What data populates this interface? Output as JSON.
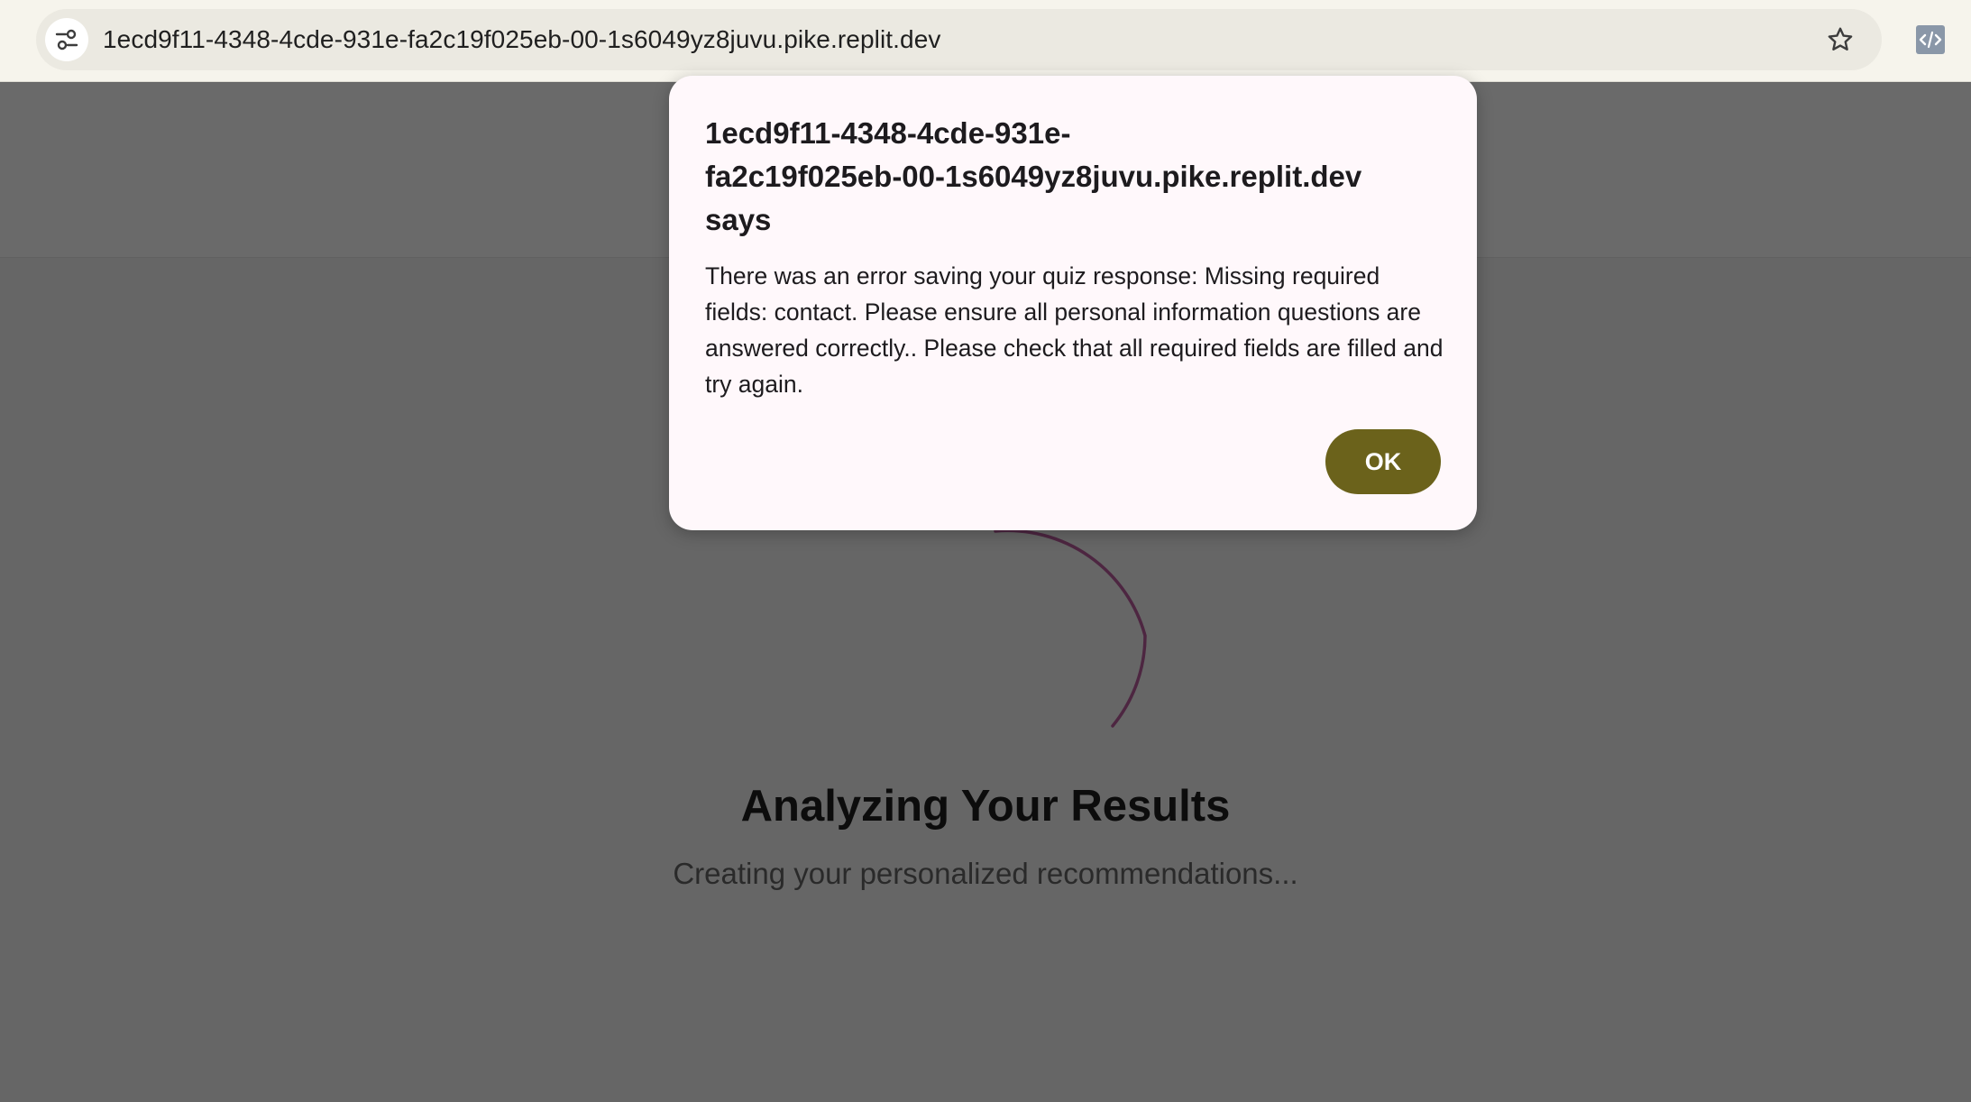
{
  "browser": {
    "url": "1ecd9f11-4348-4cde-931e-fa2c19f025eb-00-1s6049yz8juvu.pike.replit.dev",
    "icons": [
      "site-settings-icon",
      "bookmark-star-icon",
      "code-extension-icon"
    ]
  },
  "dialog": {
    "title_line1": "1ecd9f11-4348-4cde-931e-",
    "title_line2": "fa2c19f025eb-00-1s6049yz8juvu.pike.replit.dev",
    "title_line3": "says",
    "message": "There was an error saving your quiz response: Missing required fields: contact. Please ensure all personal information questions are answered correctly.. Please check that all required fields are filled and try again.",
    "ok_label": "OK"
  },
  "page": {
    "title": "Analyzing Your Results",
    "subtitle": "Creating your personalized recommendations..."
  },
  "colors": {
    "overlay": "#666666",
    "dialog_bg": "#fff8fb",
    "ok_button": "#6b621b",
    "spinner": "#4a1f3d"
  }
}
